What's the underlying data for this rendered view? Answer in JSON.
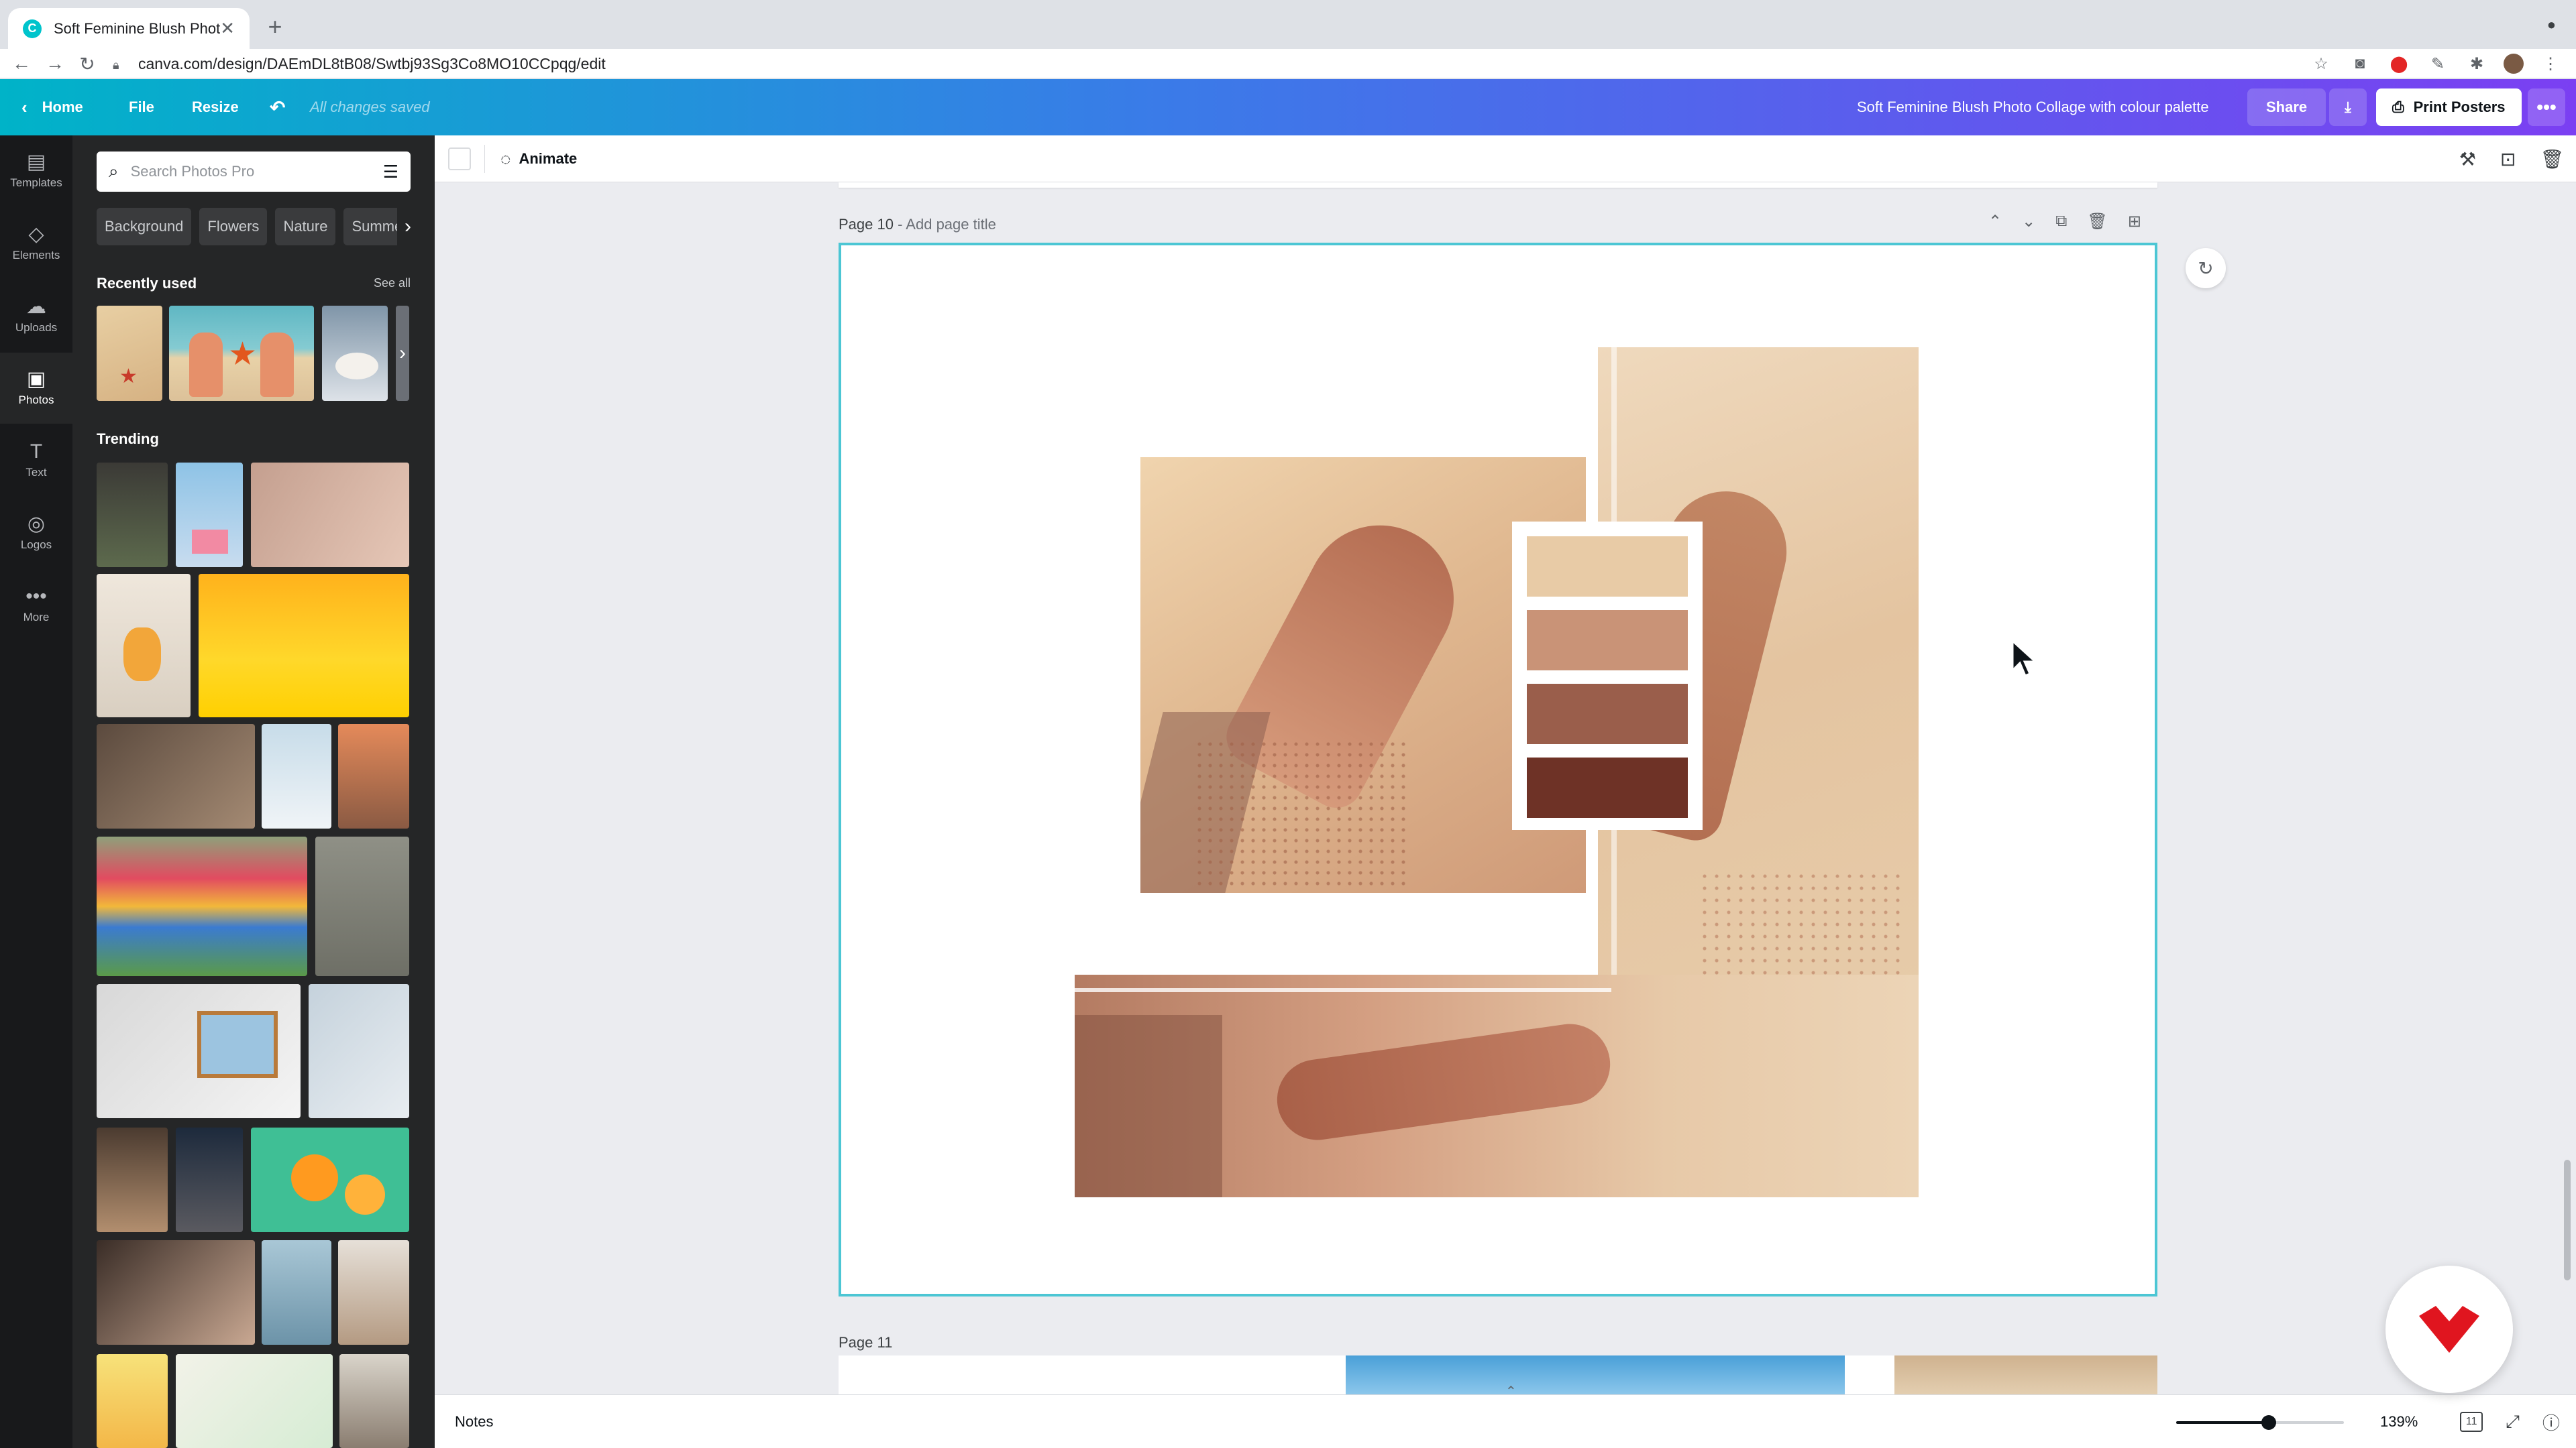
{
  "browser": {
    "tab_title": "Soft Feminine Blush Photo Col",
    "tab_close": "✕",
    "new_tab": "+",
    "url": "canva.com/design/DAEmDL8tB08/Swtbj93Sg3Co8MO10CCpqg/edit"
  },
  "topbar": {
    "home": "Home",
    "file": "File",
    "resize": "Resize",
    "saved": "All changes saved",
    "design_title": "Soft Feminine Blush Photo Collage with colour palette",
    "share": "Share",
    "print": "Print Posters",
    "more": "•••"
  },
  "rail": {
    "items": [
      {
        "label": "Templates",
        "icon": "templates-icon"
      },
      {
        "label": "Elements",
        "icon": "elements-icon"
      },
      {
        "label": "Uploads",
        "icon": "uploads-icon"
      },
      {
        "label": "Photos",
        "icon": "photos-icon"
      },
      {
        "label": "Text",
        "icon": "text-icon"
      },
      {
        "label": "Logos",
        "icon": "logos-icon"
      },
      {
        "label": "More",
        "icon": "more-icon"
      }
    ]
  },
  "panel": {
    "search_placeholder": "Search Photos Pro",
    "chips": [
      "Background",
      "Flowers",
      "Nature",
      "Summer"
    ],
    "recently_used": "Recently used",
    "see_all": "See all",
    "trending": "Trending"
  },
  "toolbar": {
    "animate": "Animate"
  },
  "canvas": {
    "page10_label": "Page 10",
    "page10_title": " - Add page title",
    "page11_label": "Page 11",
    "palette": [
      "#e8cba6",
      "#c99377",
      "#9a5e4b",
      "#6e3226"
    ]
  },
  "bottom": {
    "notes": "Notes",
    "zoom": "139%",
    "zoom_level": 0.55,
    "page_count": "11"
  },
  "colors": {
    "accent": "#4cc6d4",
    "rail_bg": "#18191b",
    "panel_bg": "#252627"
  }
}
